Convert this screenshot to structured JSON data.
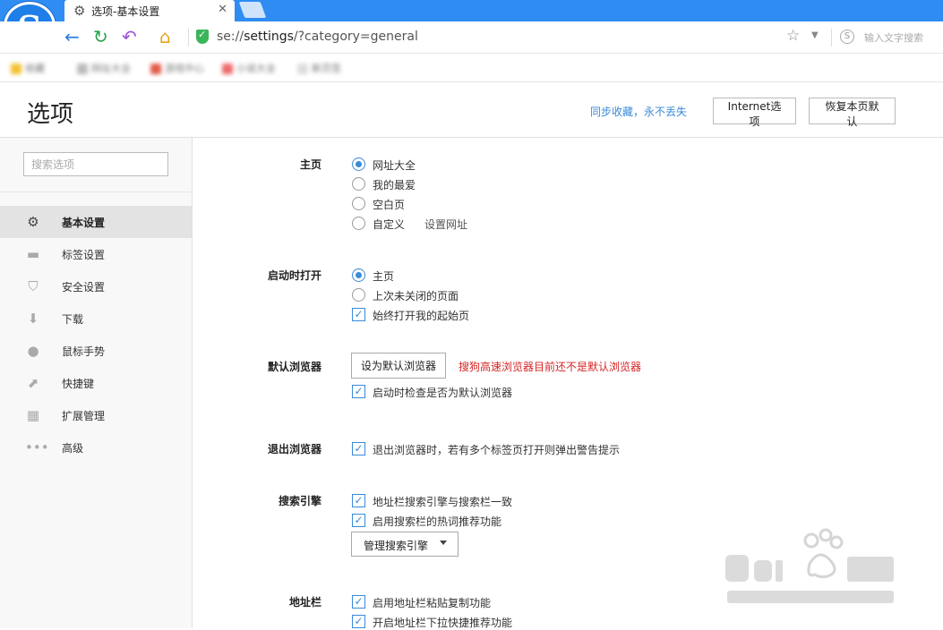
{
  "tab": {
    "title": "选项-基本设置",
    "close": "✕"
  },
  "address": {
    "scheme": "se://",
    "host": "settings",
    "rest": "/?category=general",
    "search_placeholder": "输入文字搜索"
  },
  "bookmarks": [
    {
      "label": "收藏",
      "color": "#f2c230"
    },
    {
      "label": "网址大全",
      "color": "#bbbbbb"
    },
    {
      "label": "游戏中心",
      "color": "#e25b4b"
    },
    {
      "label": "小说大全",
      "color": "#ef6b6b"
    },
    {
      "label": "新页签",
      "color": "#dddddd"
    }
  ],
  "header": {
    "title": "选项",
    "sync_link": "同步收藏，永不丢失",
    "internet_button": "Internet选项",
    "restore_button": "恢复本页默认"
  },
  "sidebar": {
    "search_placeholder": "搜索选项",
    "items": [
      {
        "label": "基本设置",
        "icon": "gear-icon",
        "active": true
      },
      {
        "label": "标签设置",
        "icon": "tab-icon"
      },
      {
        "label": "安全设置",
        "icon": "shield-icon"
      },
      {
        "label": "下载",
        "icon": "download-icon"
      },
      {
        "label": "鼠标手势",
        "icon": "mouse-icon"
      },
      {
        "label": "快捷键",
        "icon": "shortcut-arrow-icon"
      },
      {
        "label": "扩展管理",
        "icon": "grid-icon"
      },
      {
        "label": "高级",
        "icon": "more-dots-icon"
      }
    ]
  },
  "sections": {
    "homepage": {
      "label": "主页",
      "options": [
        "网址大全",
        "我的最爱",
        "空白页",
        "自定义"
      ],
      "selected": 0,
      "custom_link": "设置网址"
    },
    "startup": {
      "label": "启动时打开",
      "options": [
        "主页",
        "上次未关闭的页面"
      ],
      "selected": 0,
      "always_open_start": "始终打开我的起始页"
    },
    "default_browser": {
      "label": "默认浏览器",
      "button": "设为默认浏览器",
      "warning": "搜狗高速浏览器目前还不是默认浏览器",
      "check_on_start": "启动时检查是否为默认浏览器"
    },
    "exit": {
      "label": "退出浏览器",
      "warn_multi_tab": "退出浏览器时，若有多个标签页打开则弹出警告提示"
    },
    "search_engine": {
      "label": "搜索引擎",
      "sync_engine": "地址栏搜索引擎与搜索栏一致",
      "hot_words": "启用搜索栏的热词推荐功能",
      "manage": "管理搜索引擎"
    },
    "address_bar": {
      "label": "地址栏",
      "paste_copy": "启用地址栏粘贴复制功能",
      "dropdown_recommend": "开启地址栏下拉快捷推荐功能"
    }
  },
  "colors": {
    "accent": "#3a8ad8",
    "warning": "#d62525",
    "tabbar": "#2f8cf2"
  }
}
